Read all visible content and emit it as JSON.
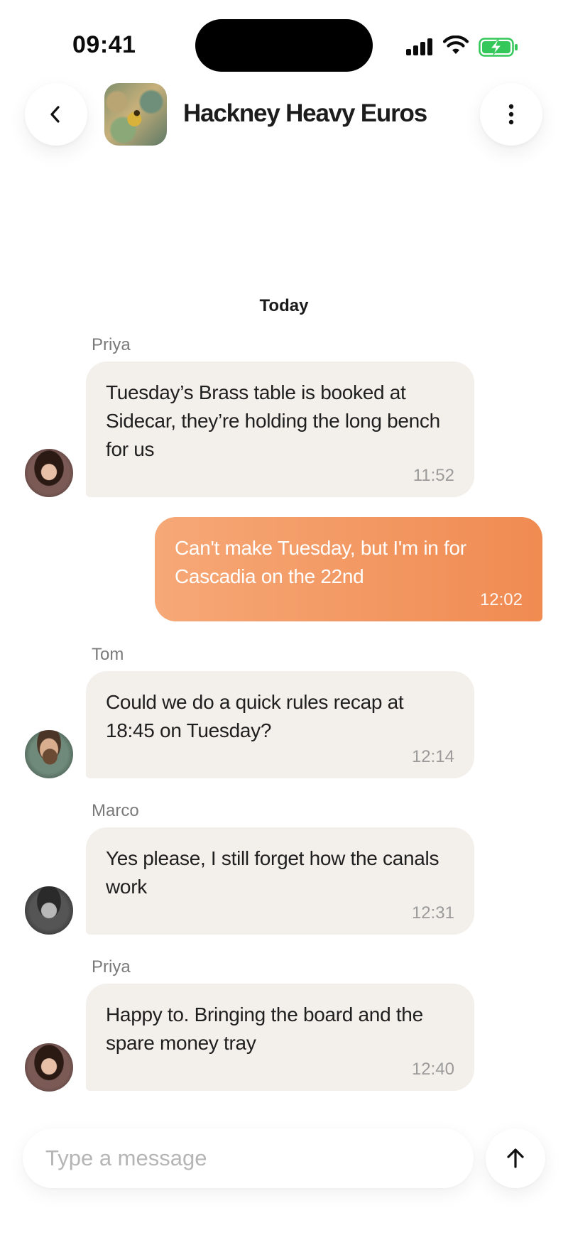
{
  "status_bar": {
    "time": "09:41",
    "icons": [
      "signal-icon",
      "wifi-icon",
      "battery-charging-icon"
    ],
    "battery_color": "#34c759"
  },
  "header": {
    "back_icon": "chevron-left-icon",
    "group_name": "Hackney Heavy Euros",
    "more_icon": "more-vertical-icon"
  },
  "day_separator": "Today",
  "messages": [
    {
      "direction": "in",
      "sender": "Priya",
      "text": "Tuesday’s Brass table is booked at Sidecar, they’re holding the long bench for us",
      "time": "11:52"
    },
    {
      "direction": "out",
      "text": "Can't make Tuesday, but I'm in for Cascadia on the 22nd",
      "time": "12:02"
    },
    {
      "direction": "in",
      "sender": "Tom",
      "text": "Could we do a quick rules recap at 18:45 on Tuesday?",
      "time": "12:14"
    },
    {
      "direction": "in",
      "sender": "Marco",
      "text": "Yes please, I still forget how the canals work",
      "time": "12:31"
    },
    {
      "direction": "in",
      "sender": "Priya",
      "text": "Happy to. Bringing the board and the spare money tray",
      "time": "12:40"
    }
  ],
  "composer": {
    "placeholder": "Type a message",
    "send_icon": "arrow-up-icon"
  },
  "colors": {
    "outgoing_bubble_start": "#f6a877",
    "outgoing_bubble_end": "#f08b52",
    "incoming_bubble": "#f3f0eb"
  }
}
